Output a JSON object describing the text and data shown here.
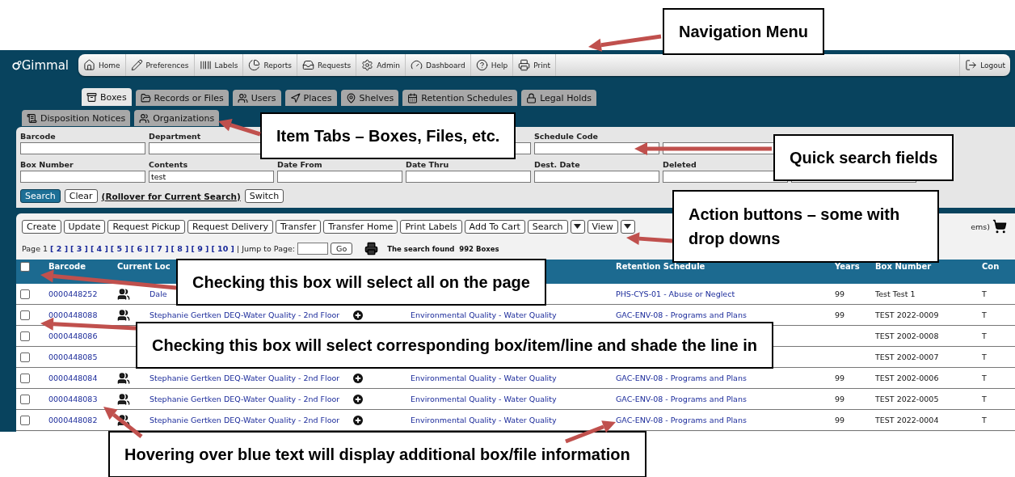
{
  "logo": {
    "text": "Gimmal"
  },
  "nav": {
    "items": [
      {
        "label": "Home"
      },
      {
        "label": "Preferences"
      },
      {
        "label": "Labels"
      },
      {
        "label": "Reports"
      },
      {
        "label": "Requests"
      },
      {
        "label": "Admin"
      },
      {
        "label": "Dashboard"
      },
      {
        "label": "Help"
      },
      {
        "label": "Print"
      }
    ],
    "logout": {
      "label": "Logout"
    }
  },
  "tabs": [
    {
      "label": "Boxes",
      "selected": true
    },
    {
      "label": "Records or Files",
      "selected": false
    },
    {
      "label": "Users",
      "selected": false
    },
    {
      "label": "Places",
      "selected": false
    },
    {
      "label": "Shelves",
      "selected": false
    },
    {
      "label": "Retention Schedules",
      "selected": false
    },
    {
      "label": "Legal Holds",
      "selected": false
    }
  ],
  "subtabs": [
    {
      "label": "Disposition Notices",
      "selected": false
    },
    {
      "label": "Organizations",
      "selected": false
    }
  ],
  "search_fields": [
    [
      {
        "label": "Barcode"
      },
      {
        "label": "Department"
      },
      {
        "label": "Schedule Code"
      }
    ],
    [
      {
        "label": "Box Number"
      },
      {
        "label": "Contents",
        "value": "test"
      },
      {
        "label": "Date From"
      },
      {
        "label": "Date Thru"
      },
      {
        "label": "Dest. Date"
      },
      {
        "label": "Deleted"
      }
    ]
  ],
  "search_buttons": {
    "search": "Search",
    "clear": "Clear",
    "rollover": "(Rollover for Current Search)",
    "switch": "Switch"
  },
  "actions": [
    {
      "label": "Create",
      "dropdown": false
    },
    {
      "label": "Update",
      "dropdown": false
    },
    {
      "label": "Request Pickup",
      "dropdown": false
    },
    {
      "label": "Request Delivery",
      "dropdown": false
    },
    {
      "label": "Transfer",
      "dropdown": false
    },
    {
      "label": "Transfer Home",
      "dropdown": false
    },
    {
      "label": "Print Labels",
      "dropdown": false
    },
    {
      "label": "Add To Cart",
      "dropdown": false
    },
    {
      "label": "Search",
      "dropdown": true
    },
    {
      "label": "View",
      "dropdown": true
    }
  ],
  "cart_text": "ems)",
  "pager": {
    "current": "Page 1",
    "pages": [
      "[ 2 ]",
      "[ 3 ]",
      "[ 4 ]",
      "[ 5 ]",
      "[ 6 ]",
      "[ 7 ]",
      "[ 8 ]",
      "[ 9 ]",
      "[ 10 ]"
    ],
    "jump_label": "| Jump to Page:",
    "go": "Go",
    "found": "The search found  992 Boxes"
  },
  "table": {
    "select_all_checked": false,
    "columns": {
      "barcode": "Barcode",
      "location": "Current Loc",
      "retention": "Retention Schedule",
      "years": "Years",
      "box_number": "Box Number",
      "col_last": "Con"
    },
    "rows": [
      {
        "checked": false,
        "barcode": "0000448252",
        "location": "Dale",
        "retention": "PHS-CYS-01 - Abuse or Neglect",
        "years": "99",
        "box_number": "Test Test 1",
        "col_last": "T"
      },
      {
        "checked": false,
        "barcode": "0000448088",
        "location": "Stephanie Gertken DEQ-Water Quality - 2nd Floor",
        "department": "Environmental Quality - Water Quality",
        "retention": "GAC-ENV-08 - Programs and Plans",
        "years": "99",
        "box_number": "TEST 2022-0009",
        "col_last": "T"
      },
      {
        "checked": false,
        "barcode": "0000448086",
        "box_number": "TEST 2002-0008",
        "col_last": "T"
      },
      {
        "checked": false,
        "barcode": "0000448085",
        "box_number": "TEST 2002-0007",
        "col_last": "T"
      },
      {
        "checked": false,
        "barcode": "0000448084",
        "location": "Stephanie Gertken DEQ-Water Quality - 2nd Floor",
        "department": "Environmental Quality - Water Quality",
        "retention": "GAC-ENV-08 - Programs and Plans",
        "years": "99",
        "box_number": "TEST 2002-0006",
        "col_last": "T"
      },
      {
        "checked": false,
        "barcode": "0000448083",
        "location": "Stephanie Gertken DEQ-Water Quality - 2nd Floor",
        "department": "Environmental Quality - Water Quality",
        "retention": "GAC-ENV-08 - Programs and Plans",
        "years": "99",
        "box_number": "TEST 2022-0005",
        "col_last": "T"
      },
      {
        "checked": false,
        "barcode": "0000448082",
        "location": "Stephanie Gertken DEQ-Water Quality - 2nd Floor",
        "department": "Environmental Quality - Water Quality",
        "retention": "GAC-ENV-08 - Programs and Plans",
        "years": "99",
        "box_number": "TEST 2022-0004",
        "col_last": "T"
      }
    ]
  },
  "callouts": [
    {
      "text": "Navigation Menu"
    },
    {
      "text": "Item Tabs – Boxes, Files, etc."
    },
    {
      "text": "Quick search fields"
    },
    {
      "text": "Action buttons – some with drop downs"
    },
    {
      "text": "Checking this box will select all on the page"
    },
    {
      "text": "Checking this box will select corresponding box/item/line and shade the line in"
    },
    {
      "text": "Hovering over blue text will display additional box/file information"
    }
  ]
}
